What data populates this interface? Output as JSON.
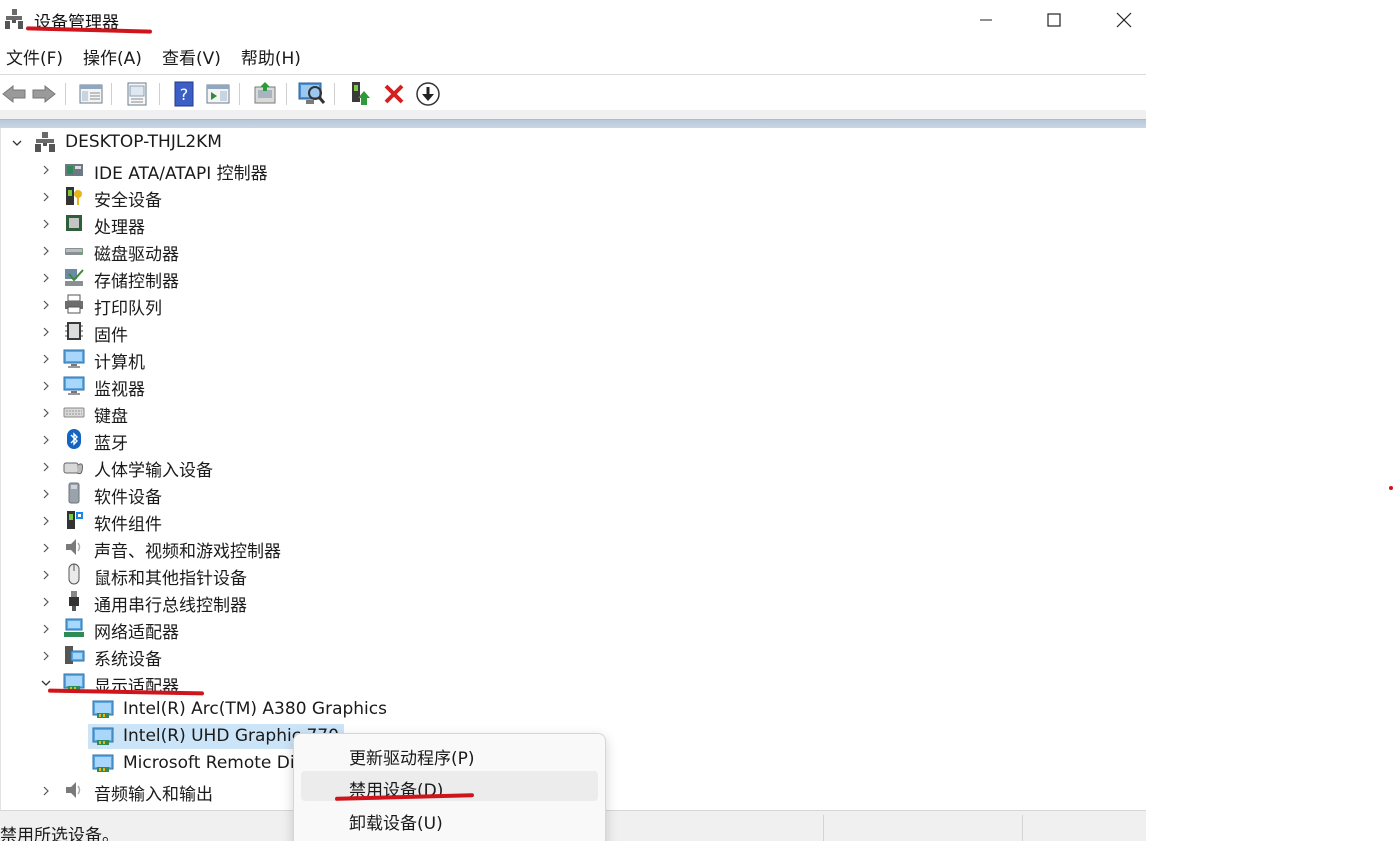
{
  "window": {
    "title": "设备管理器"
  },
  "menu": [
    "文件(F)",
    "操作(A)",
    "查看(V)",
    "帮助(H)"
  ],
  "toolbar": [
    "back-icon",
    "forward-icon",
    "show-hide-tree-icon",
    "properties-icon",
    "help-icon",
    "action-pane-icon",
    "update-driver-icon",
    "scan-hardware-icon",
    "add-driver-icon",
    "uninstall-icon",
    "disable-icon"
  ],
  "tree": {
    "root": "DESKTOP-THJL2KM",
    "categories": [
      {
        "label": "IDE ATA/ATAPI 控制器",
        "icon": "ide-controller-icon"
      },
      {
        "label": "安全设备",
        "icon": "security-device-icon"
      },
      {
        "label": "处理器",
        "icon": "processor-icon"
      },
      {
        "label": "磁盘驱动器",
        "icon": "disk-drive-icon"
      },
      {
        "label": "存储控制器",
        "icon": "storage-controller-icon"
      },
      {
        "label": "打印队列",
        "icon": "printer-icon"
      },
      {
        "label": "固件",
        "icon": "firmware-icon"
      },
      {
        "label": "计算机",
        "icon": "computer-icon"
      },
      {
        "label": "监视器",
        "icon": "monitor-icon"
      },
      {
        "label": "键盘",
        "icon": "keyboard-icon"
      },
      {
        "label": "蓝牙",
        "icon": "bluetooth-icon"
      },
      {
        "label": "人体学输入设备",
        "icon": "hid-icon"
      },
      {
        "label": "软件设备",
        "icon": "software-device-icon"
      },
      {
        "label": "软件组件",
        "icon": "software-component-icon"
      },
      {
        "label": "声音、视频和游戏控制器",
        "icon": "sound-icon"
      },
      {
        "label": "鼠标和其他指针设备",
        "icon": "mouse-icon"
      },
      {
        "label": "通用串行总线控制器",
        "icon": "usb-icon"
      },
      {
        "label": "网络适配器",
        "icon": "network-adapter-icon"
      },
      {
        "label": "系统设备",
        "icon": "system-device-icon"
      },
      {
        "label": "显示适配器",
        "icon": "display-adapter-icon",
        "expanded": true
      },
      {
        "label": "音频输入和输出",
        "icon": "audio-io-icon"
      }
    ],
    "display_children": [
      "Intel(R) Arc(TM) A380 Graphics",
      "Intel(R) UHD Graphic  770",
      "Microsoft Remote Di"
    ]
  },
  "context_menu": {
    "items": [
      "更新驱动程序(P)",
      "禁用设备(D)",
      "卸载设备(U)"
    ],
    "highlighted_index": 1
  },
  "status": {
    "text": "禁用所选设备。"
  },
  "colors": {
    "selection": "#cce4f7",
    "annotation": "#d0141b",
    "stripe": "#c4d2e1"
  }
}
